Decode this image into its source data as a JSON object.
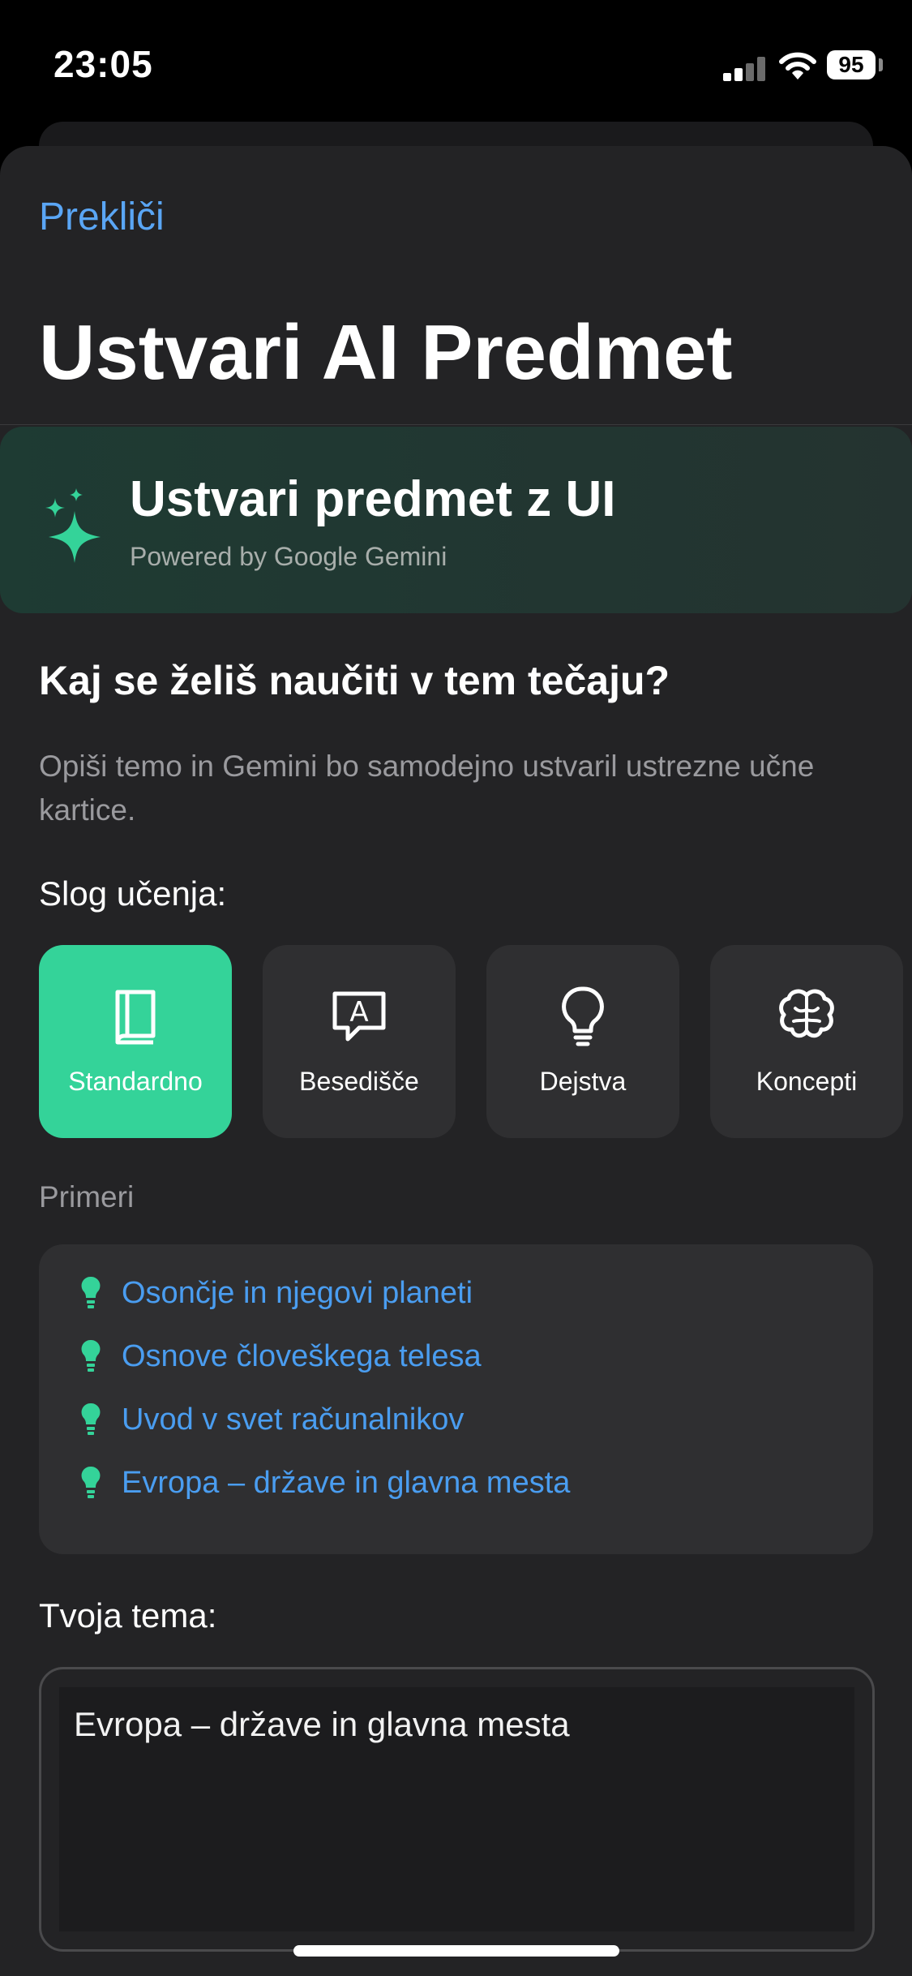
{
  "status_bar": {
    "time": "23:05",
    "battery": "95"
  },
  "header": {
    "cancel_label": "Prekliči",
    "title": "Ustvari AI Predmet"
  },
  "ai_banner": {
    "title": "Ustvari predmet z UI",
    "subtitle": "Powered by Google Gemini",
    "icon": "sparkle-icon"
  },
  "prompt": {
    "question": "Kaj se želiš naučiti v tem tečaju?",
    "description": "Opiši temo in Gemini bo samodejno ustvaril ustrezne učne kartice."
  },
  "learning_style": {
    "label": "Slog učenja:",
    "options": [
      {
        "label": "Standardno",
        "icon": "book-icon",
        "selected": true
      },
      {
        "label": "Besedišče",
        "icon": "speech-bubble-a-icon",
        "selected": false
      },
      {
        "label": "Dejstva",
        "icon": "lightbulb-icon",
        "selected": false
      },
      {
        "label": "Koncepti",
        "icon": "brain-icon",
        "selected": false
      }
    ]
  },
  "examples": {
    "label": "Primeri",
    "items": [
      "Osončje in njegovi planeti",
      "Osnove človeškega telesa",
      "Uvod v svet računalnikov",
      "Evropa – države in glavna mesta"
    ]
  },
  "topic": {
    "label": "Tvoja tema:",
    "value": "Evropa – države in glavna mesta"
  },
  "colors": {
    "accent": "#34d399",
    "link": "#4a9df0",
    "cancel": "#5aa6f5",
    "background": "#232325"
  }
}
